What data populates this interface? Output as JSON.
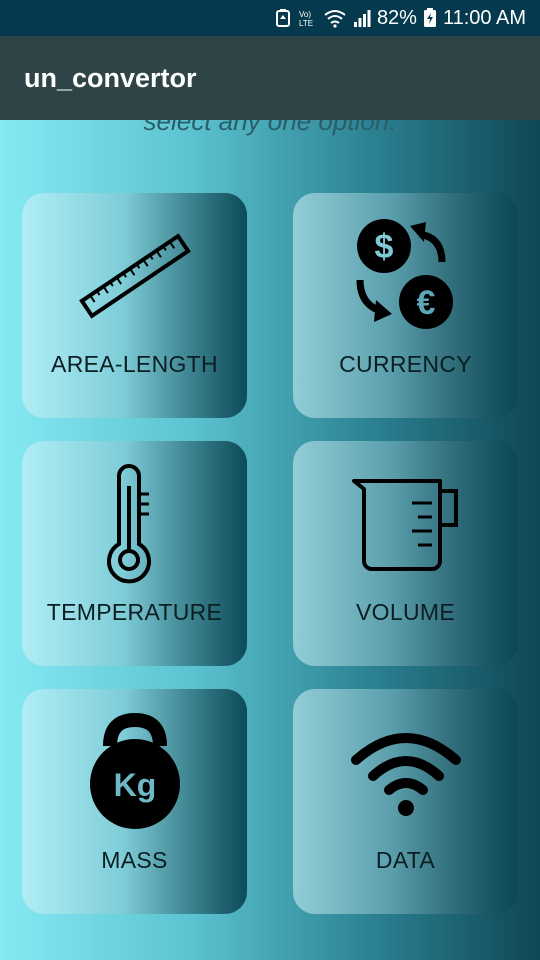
{
  "status_bar": {
    "battery_percent": "82%",
    "time": "11:00 AM",
    "icons": [
      "data-saver-icon",
      "volte-icon",
      "wifi-icon",
      "signal-icon",
      "battery-icon"
    ],
    "volte_text": "Vo) LTE"
  },
  "app_bar": {
    "title": "un_convertor"
  },
  "main": {
    "subtitle": "select any one option.",
    "options": [
      {
        "label": "AREA-LENGTH",
        "icon": "ruler-icon"
      },
      {
        "label": "CURRENCY",
        "icon": "currency-exchange-icon"
      },
      {
        "label": "TEMPERATURE",
        "icon": "thermometer-icon"
      },
      {
        "label": "VOLUME",
        "icon": "measuring-cup-icon"
      },
      {
        "label": "MASS",
        "icon": "kettlebell-icon",
        "icon_text": "Kg"
      },
      {
        "label": "DATA",
        "icon": "wifi-data-icon"
      }
    ]
  },
  "colors": {
    "status_bar_bg": "#053a4e",
    "app_bar_bg": "#2f4446",
    "gradient_light": "#86eaf4",
    "gradient_dark": "#0f4653",
    "label_text": "#0b1e22"
  }
}
